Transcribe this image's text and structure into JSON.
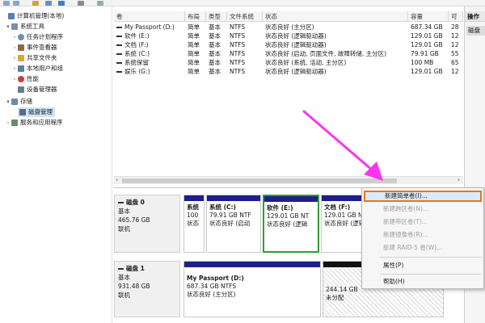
{
  "tree": {
    "items": [
      {
        "label": "计算机管理(本地)",
        "expander": "",
        "icon_color": "#5a7fb5"
      },
      {
        "label": "系统工具",
        "expander": "▾",
        "icon_color": "#7a8ea8"
      },
      {
        "label": "任务计划程序",
        "expander": "›",
        "icon_color": "#6f8fb0"
      },
      {
        "label": "事件查看器",
        "expander": "›",
        "icon_color": "#8a6d4f"
      },
      {
        "label": "共享文件夹",
        "expander": "›",
        "icon_color": "#d9a640"
      },
      {
        "label": "本地用户和组",
        "expander": "›",
        "icon_color": "#5c7fa8"
      },
      {
        "label": "性能",
        "expander": "›",
        "icon_color": "#c04040"
      },
      {
        "label": "设备管理器",
        "expander": "",
        "icon_color": "#6a7a8a"
      },
      {
        "label": "存储",
        "expander": "▾",
        "icon_color": "#6a8aaa"
      },
      {
        "label": "磁盘管理",
        "expander": "",
        "icon_color": "#5a6a80"
      },
      {
        "label": "服务和应用程序",
        "expander": "›",
        "icon_color": "#6a8a6a"
      }
    ]
  },
  "list": {
    "columns": [
      "卷",
      "布局",
      "类型",
      "文件系统",
      "状态",
      "容量",
      "可"
    ],
    "rows": [
      {
        "vol": "My Passport (D:)",
        "layout": "简单",
        "type": "基本",
        "fs": "NTFS",
        "status": "状态良好 (主分区)",
        "capacity": "687.34 GB",
        "free": "28"
      },
      {
        "vol": "软件 (E:)",
        "layout": "简单",
        "type": "基本",
        "fs": "NTFS",
        "status": "状态良好 (逻辑驱动器)",
        "capacity": "129.01 GB",
        "free": "12"
      },
      {
        "vol": "文档 (F:)",
        "layout": "简单",
        "type": "基本",
        "fs": "NTFS",
        "status": "状态良好 (逻辑驱动器)",
        "capacity": "129.01 GB",
        "free": "12"
      },
      {
        "vol": "系统 (C:)",
        "layout": "简单",
        "type": "基本",
        "fs": "NTFS",
        "status": "状态良好 (启动, 页面文件, 故障转储, 主分区)",
        "capacity": "79.91 GB",
        "free": "55"
      },
      {
        "vol": "系统保留",
        "layout": "简单",
        "type": "基本",
        "fs": "NTFS",
        "status": "状态良好 (系统, 活动, 主分区)",
        "capacity": "100 MB",
        "free": "65"
      },
      {
        "vol": "娱乐 (G:)",
        "layout": "简单",
        "type": "基本",
        "fs": "NTFS",
        "status": "状态良好 (逻辑驱动器)",
        "capacity": "129.01 GB",
        "free": "12"
      }
    ],
    "scroll_left": "‹",
    "scroll_right": "›"
  },
  "actions": {
    "header": "操作",
    "item": "磁盘"
  },
  "disks": {
    "disk0": {
      "name": "磁盘 0",
      "type": "基本",
      "size": "465.76 GB",
      "status": "联机",
      "partitions": [
        {
          "name": "系统",
          "size": "100",
          "status": "状态"
        },
        {
          "name": "系统 (C:)",
          "size": "79.91 GB NTF",
          "status": "状态良好 (启动"
        },
        {
          "name": "软件 (E:)",
          "size": "129.01 GB NT",
          "status": "状态良好 (逻辑"
        },
        {
          "name": "文档 (F:)",
          "size": "129.01 GB NT",
          "status": "状态良好 (逻辑"
        }
      ]
    },
    "disk1": {
      "name": "磁盘 1",
      "type": "基本",
      "size": "931.48 GB",
      "status": "联机",
      "partitions": [
        {
          "name": "My Passport (D:)",
          "size": "687.34 GB NTFS",
          "status": "状态良好 (主分区)"
        },
        {
          "name": "",
          "size": "244.14 GB",
          "status": "未分配"
        }
      ]
    }
  },
  "context_menu": {
    "items": [
      {
        "label": "新建简单卷(I)...",
        "disabled": false
      },
      {
        "label": "新建跨区卷(N)...",
        "disabled": true
      },
      {
        "label": "新建带区卷(T)...",
        "disabled": true
      },
      {
        "label": "新建镜像卷(R)...",
        "disabled": true
      },
      {
        "label": "新建 RAID-5 卷(W)...",
        "disabled": true
      },
      {
        "label": "属性(P)",
        "disabled": false
      },
      {
        "label": "帮助(H)",
        "disabled": false
      }
    ]
  },
  "colors": {
    "partition_bar": "#1f1f8a",
    "selected_partition_border": "#2e9e2e",
    "highlight_border": "#e8751a",
    "arrow": "#ff33ee"
  }
}
